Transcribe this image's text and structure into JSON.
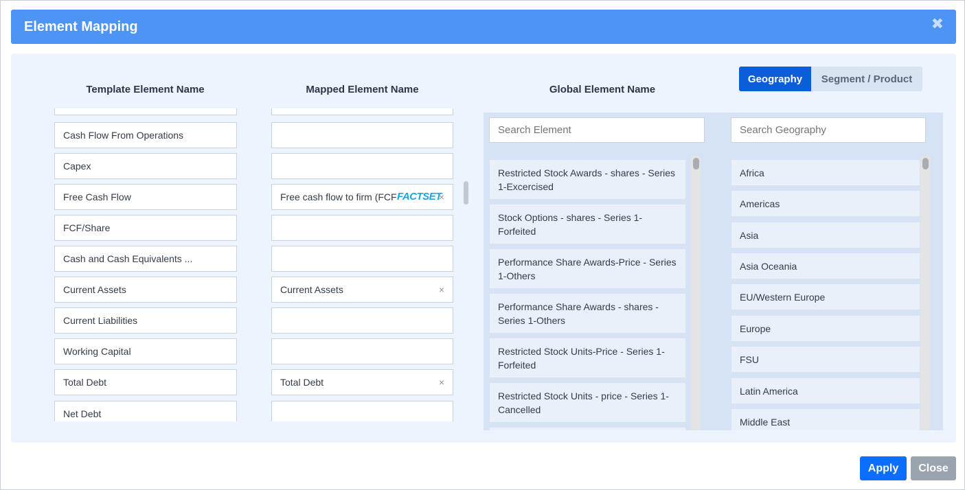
{
  "dialog": {
    "title": "Element Mapping",
    "close_icon": "✖"
  },
  "columns": {
    "template": "Template Element Name",
    "mapped": "Mapped Element Name",
    "global": "Global Element Name"
  },
  "toggle": {
    "active": "Geography",
    "inactive": "Segment / Product"
  },
  "rows": [
    {
      "template": "Cash Flow From Operations",
      "mapped": "",
      "clear": ""
    },
    {
      "template": "Capex",
      "mapped": "",
      "clear": ""
    },
    {
      "template": "Free Cash Flow",
      "mapped": "Free cash flow to firm (FCFF",
      "clear": "×",
      "badge": "FACTSET"
    },
    {
      "template": "FCF/Share",
      "mapped": "",
      "clear": ""
    },
    {
      "template": "Cash and Cash Equivalents ...",
      "mapped": "",
      "clear": ""
    },
    {
      "template": "Current Assets",
      "mapped": "Current Assets",
      "clear": "×"
    },
    {
      "template": "Current Liabilities",
      "mapped": "",
      "clear": ""
    },
    {
      "template": "Working Capital",
      "mapped": "",
      "clear": ""
    },
    {
      "template": "Total Debt",
      "mapped": "Total Debt",
      "clear": "×"
    },
    {
      "template": "Net Debt",
      "mapped": "",
      "clear": ""
    }
  ],
  "search": {
    "element_placeholder": "Search Element",
    "geography_placeholder": "Search Geography"
  },
  "global_elements": [
    "Restricted Stock Awards - shares - Series 1-Excercised",
    "Stock Options - shares - Series 1-Forfeited",
    "Performance Share Awards-Price - Series 1-Others",
    "Performance Share Awards - shares - Series 1-Others",
    "Restricted Stock Units-Price - Series 1-Forfeited",
    "Restricted Stock Units - price - Series 1-Cancelled"
  ],
  "geographies": [
    "Africa",
    "Americas",
    "Asia",
    "Asia Oceania",
    "EU/Western Europe",
    "Europe",
    "FSU",
    "Latin America",
    "Middle East"
  ],
  "footer": {
    "apply": "Apply",
    "close": "Close"
  },
  "colors": {
    "header": "#4d94f5",
    "primary": "#0b6efd",
    "secondary": "#9aa4ae",
    "factset": "#16a6e0"
  }
}
